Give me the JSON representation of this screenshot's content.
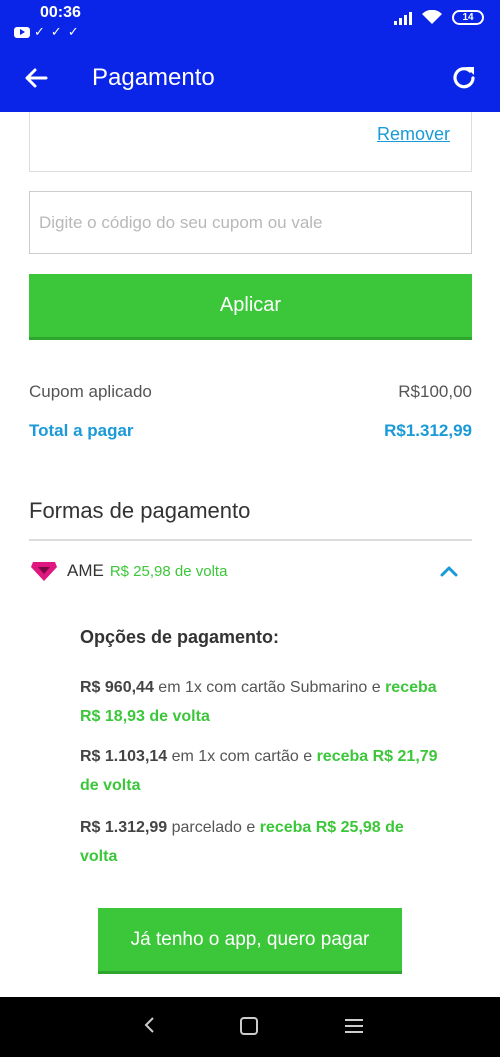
{
  "status_bar": {
    "time": "00:36",
    "battery": "14"
  },
  "header": {
    "title": "Pagamento"
  },
  "coupon": {
    "remove_label": "Remover",
    "input_placeholder": "Digite o código do seu cupom ou vale",
    "apply_label": "Aplicar"
  },
  "summary": {
    "coupon_label": "Cupom aplicado",
    "coupon_value": "R$100,00",
    "total_label": "Total a pagar",
    "total_value": "R$1.312,99"
  },
  "payment": {
    "section_title": "Formas de pagamento",
    "ame": {
      "name": "AME",
      "cashback": "R$ 25,98 de volta",
      "options_title": "Opções de pagamento:",
      "options": [
        {
          "price": "R$ 960,44",
          "text": " em 1x com cartão Submarino e ",
          "cashback": "receba R$ 18,93 de volta"
        },
        {
          "price": "R$ 1.103,14",
          "text": " em 1x com cartão e ",
          "cashback": "receba R$ 21,79 de volta"
        },
        {
          "price": "R$ 1.312,99",
          "text": " parcelado e ",
          "cashback": "receba R$ 25,98 de volta"
        }
      ],
      "app_button_label": "Já tenho o app, quero pagar"
    }
  },
  "colors": {
    "primary": "#0a24e8",
    "accent_green": "#3cc73a",
    "link_blue": "#1a9ad6",
    "ame_pink": "#e0177f"
  },
  "icons": [
    "back-arrow-icon",
    "refresh-icon",
    "ame-heart-icon",
    "chevron-up-icon",
    "nav-back-icon",
    "nav-home-icon",
    "nav-menu-icon"
  ]
}
